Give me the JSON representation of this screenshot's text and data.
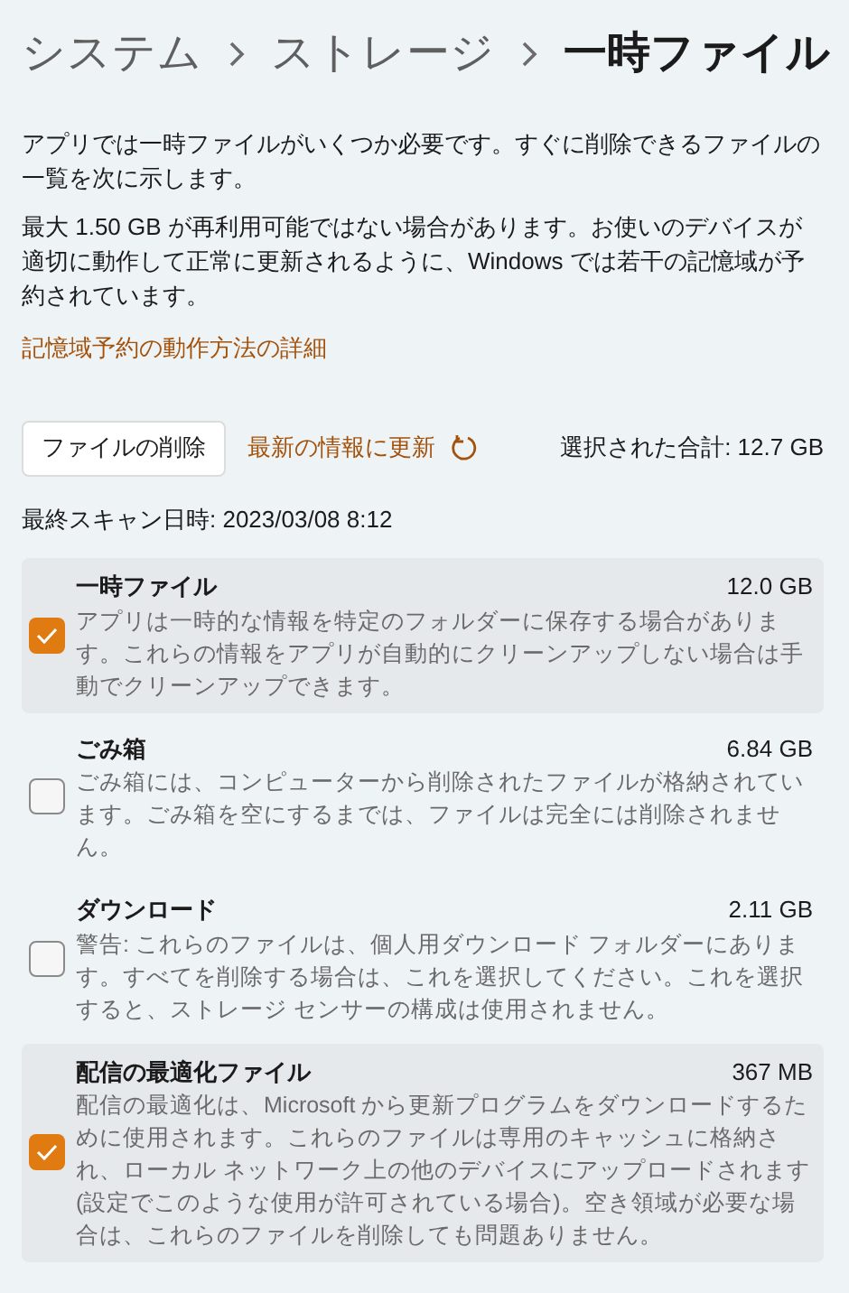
{
  "breadcrumb": [
    {
      "label": "システム",
      "current": false
    },
    {
      "label": "ストレージ",
      "current": false
    },
    {
      "label": "一時ファイル",
      "current": true
    }
  ],
  "intro": [
    "アプリでは一時ファイルがいくつか必要です。すぐに削除できるファイルの一覧を次に示します。",
    "最大 1.50 GB が再利用可能ではない場合があります。お使いのデバイスが適切に動作して正常に更新されるように、Windows では若干の記憶域が予約されています。"
  ],
  "learn_more_link": "記憶域予約の動作方法の詳細",
  "toolbar": {
    "delete_button": "ファイルの削除",
    "refresh_link": "最新の情報に更新",
    "selected_total": "選択された合計: 12.7 GB"
  },
  "last_scan": "最終スキャン日時: 2023/03/08 8:12",
  "items": [
    {
      "name": "一時ファイル",
      "size": "12.0 GB",
      "description": "アプリは一時的な情報を特定のフォルダーに保存する場合があります。これらの情報をアプリが自動的にクリーンアップしない場合は手動でクリーンアップできます。",
      "checked": true
    },
    {
      "name": "ごみ箱",
      "size": "6.84 GB",
      "description": "ごみ箱には、コンピューターから削除されたファイルが格納されています。ごみ箱を空にするまでは、ファイルは完全には削除されません。",
      "checked": false
    },
    {
      "name": "ダウンロード",
      "size": "2.11 GB",
      "description": "警告: これらのファイルは、個人用ダウンロード フォルダーにあります。すべてを削除する場合は、これを選択してください。これを選択すると、ストレージ センサーの構成は使用されません。",
      "checked": false
    },
    {
      "name": "配信の最適化ファイル",
      "size": "367 MB",
      "description": "配信の最適化は、Microsoft から更新プログラムをダウンロードするために使用されます。これらのファイルは専用のキャッシュに格納され、ローカル ネットワーク上の他のデバイスにアップロードされます (設定でこのような使用が許可されている場合)。空き領域が必要な場合は、これらのファイルを削除しても問題ありません。",
      "checked": true
    }
  ]
}
